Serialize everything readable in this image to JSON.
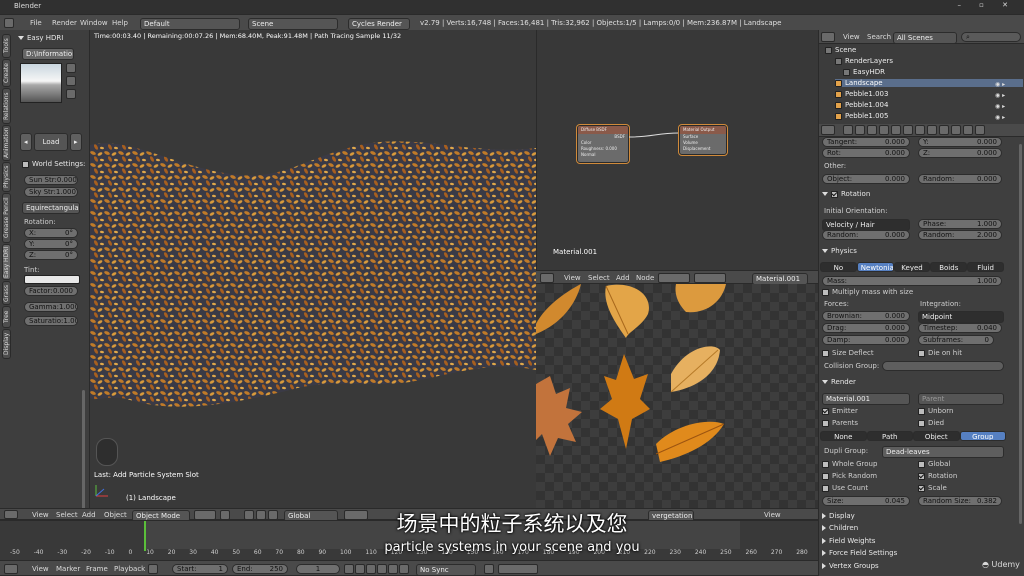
{
  "window": {
    "title": "Blender"
  },
  "topbar": {
    "menus": [
      "File",
      "Render",
      "Window",
      "Help"
    ],
    "layout": "Default",
    "scene": "Scene",
    "engine": "Cycles Render",
    "stats": "v2.79 | Verts:16,748 | Faces:16,481 | Tris:32,962 | Objects:1/5 | Lamps:0/0 | Mem:236.87M | Landscape"
  },
  "toolshelf": {
    "title": "Easy HDRI",
    "info_btn": "D:\\Information...",
    "load_btn": "Load",
    "world_settings_title": "World Settings:",
    "sun_str": {
      "label": "Sun Str:",
      "value": "0.000"
    },
    "sky_str": {
      "label": "Sky Str:",
      "value": "1.000"
    },
    "projection": "Equirectangular",
    "rotation_title": "Rotation:",
    "rot_x": {
      "label": "X:",
      "value": "0°"
    },
    "rot_y": {
      "label": "Y:",
      "value": "0°"
    },
    "rot_z": {
      "label": "Z:",
      "value": "0°"
    },
    "tint_title": "Tint:",
    "factor": {
      "label": "Factor:",
      "value": "0.000"
    },
    "gamma": {
      "label": "Gamma:",
      "value": "1.000"
    },
    "saturation": {
      "label": "Saturatio:",
      "value": "1.000"
    },
    "tabs": [
      "Tools",
      "Create",
      "Relations",
      "Animation",
      "Physics",
      "Grease Pencil",
      "Easy HDRI",
      "Grass",
      "Tree",
      "Display"
    ]
  },
  "viewport": {
    "status": "Time:00:03.40 | Remaining:00:07.26 | Mem:68.40M, Peak:91.48M | Path Tracing Sample 11/32",
    "last_op": "Last: Add Particle System Slot",
    "object_label": "(1) Landscape",
    "header": {
      "view": "View",
      "select": "Select",
      "add": "Add",
      "object": "Object",
      "mode": "Object Mode",
      "orientation": "Global"
    }
  },
  "node_editor": {
    "material": "Material.001",
    "node1": {
      "title": "Diffuse BSDF",
      "out": "BSDF",
      "color": "Color",
      "roughness": "Roughness: 0.000",
      "normal": "Normal"
    },
    "node2": {
      "title": "Material Output",
      "surface": "Surface",
      "volume": "Volume",
      "displacement": "Displacement"
    },
    "header": {
      "view": "View",
      "select": "Select",
      "add": "Add",
      "node": "Node",
      "material": "Material.001"
    }
  },
  "outliner": {
    "view": "View",
    "search": "Search",
    "filter": "All Scenes",
    "items": [
      "Scene",
      "RenderLayers",
      "EasyHDR",
      "Landscape",
      "Pebble1.003",
      "Pebble1.004",
      "Pebble1.005"
    ]
  },
  "props": {
    "tangent": {
      "label": "Tangent:",
      "value": "0.000"
    },
    "tangent_y": {
      "label": "Y:",
      "value": "0.000"
    },
    "rot": {
      "label": "Rot:",
      "value": "0.000"
    },
    "rot_z": {
      "label": "Z:",
      "value": "0.000"
    },
    "other": "Other:",
    "object": {
      "label": "Object:",
      "value": "0.000"
    },
    "random1": {
      "label": "Random:",
      "value": "0.000"
    },
    "rotation_section": "Rotation",
    "initial_orientation": "Initial Orientation:",
    "orientation_mode": "Velocity / Hair",
    "phase": {
      "label": "Phase:",
      "value": "1.000"
    },
    "random2": {
      "label": "Random:",
      "value": "0.000"
    },
    "random3": {
      "label": "Random:",
      "value": "2.000"
    },
    "physics_section": "Physics",
    "physics_types": [
      "No",
      "Newtonian",
      "Keyed",
      "Boids",
      "Fluid"
    ],
    "mass": {
      "label": "Mass:",
      "value": "1.000"
    },
    "multiply_mass": "Multiply mass with size",
    "forces": "Forces:",
    "integration": "Integration:",
    "brownian": {
      "label": "Brownian:",
      "value": "0.000"
    },
    "integrator": "Midpoint",
    "drag": {
      "label": "Drag:",
      "value": "0.000"
    },
    "timestep": {
      "label": "Timestep:",
      "value": "0.040"
    },
    "damp": {
      "label": "Damp:",
      "value": "0.000"
    },
    "subframes": {
      "label": "Subframes:",
      "value": "0"
    },
    "size_deflect": "Size Deflect",
    "die_on_hit": "Die on hit",
    "collision_group": "Collision Group:",
    "render_section": "Render",
    "render_material": "Material.001",
    "parent": "Parent",
    "emitter": "Emitter",
    "unborn": "Unborn",
    "parents": "Parents",
    "died": "Died",
    "render_types": [
      "None",
      "Path",
      "Object",
      "Group"
    ],
    "dupli_group_label": "Dupli Group:",
    "dupli_group": "Dead-leaves",
    "whole_group": "Whole Group",
    "global": "Global",
    "pick_random": "Pick Random",
    "rotation": "Rotation",
    "use_count": "Use Count",
    "scale": "Scale",
    "size": {
      "label": "Size:",
      "value": "0.045"
    },
    "random_size": {
      "label": "Random Size:",
      "value": "0.382"
    },
    "collapsed": [
      "Display",
      "Children",
      "Field Weights",
      "Force Field Settings",
      "Vertex Groups"
    ]
  },
  "timeline": {
    "ticks": [
      "-50",
      "-40",
      "-30",
      "-20",
      "-10",
      "0",
      "10",
      "20",
      "30",
      "40",
      "50",
      "60",
      "70",
      "80",
      "90",
      "100",
      "110",
      "120",
      "130",
      "140",
      "150",
      "160",
      "170",
      "180",
      "190",
      "200",
      "210",
      "220",
      "230",
      "240",
      "250",
      "260",
      "270",
      "280"
    ],
    "menus": [
      "View",
      "Marker",
      "Frame",
      "Playback"
    ],
    "start": {
      "label": "Start:",
      "value": "1"
    },
    "end": {
      "label": "End:",
      "value": "250"
    },
    "current": "1",
    "sync": "No Sync",
    "header_view": "View",
    "header_frag": "vergetation1..."
  },
  "subtitles": {
    "zh": "场景中的粒子系统以及您",
    "en": "particle systems in your scene and you"
  },
  "watermark": "Udemy",
  "colors": {
    "accent": "#5680c2",
    "bg": "#393939",
    "header": "#4a4a4a"
  }
}
